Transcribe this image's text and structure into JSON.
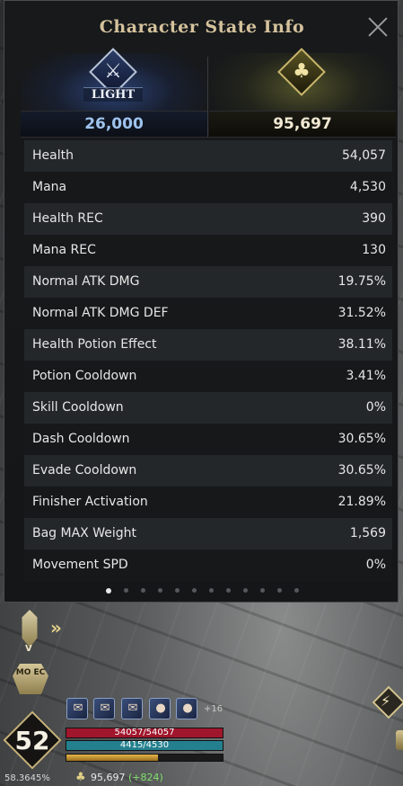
{
  "panel": {
    "title": "Character State Info",
    "close_icon": "close-icon"
  },
  "factions": {
    "light": {
      "label": "LIGHT",
      "score": "26,000",
      "icon": "crossed-swords-icon",
      "color": "#9ec3ef"
    },
    "gold": {
      "score": "95,697",
      "icon": "tree-emblem-icon",
      "color": "#f1e9d3"
    }
  },
  "stats": [
    {
      "label": "Health",
      "value": "54,057"
    },
    {
      "label": "Mana",
      "value": "4,530"
    },
    {
      "label": "Health REC",
      "value": "390"
    },
    {
      "label": "Mana REC",
      "value": "130"
    },
    {
      "label": "Normal ATK DMG",
      "value": "19.75%"
    },
    {
      "label": "Normal ATK DMG DEF",
      "value": "31.52%"
    },
    {
      "label": "Health Potion Effect",
      "value": "38.11%"
    },
    {
      "label": "Potion Cooldown",
      "value": "3.41%"
    },
    {
      "label": "Skill Cooldown",
      "value": "0%"
    },
    {
      "label": "Dash Cooldown",
      "value": "30.65%"
    },
    {
      "label": "Evade Cooldown",
      "value": "30.65%"
    },
    {
      "label": "Finisher Activation",
      "value": "21.89%"
    },
    {
      "label": "Bag MAX Weight",
      "value": "1,569"
    },
    {
      "label": "Movement SPD",
      "value": "0%"
    }
  ],
  "pagination": {
    "total": 12,
    "active": 1
  },
  "hud": {
    "weapon_slot_label": "V",
    "mode_icon_text": "MO EC",
    "level": "52",
    "quick_slots_more": "+16",
    "hp_text": "54057/54057",
    "hp_fraction": 1.0,
    "mp_text": "4415/4530",
    "mp_fraction": 0.975,
    "xp_fraction": 0.583645,
    "xp_percent": "58.3645%",
    "currency": "95,697",
    "currency_gain": "(+824)",
    "colors": {
      "hp": "#a0162c",
      "mp": "#24808e",
      "xp": "#e6b64a",
      "gain": "#7fe06a"
    }
  }
}
